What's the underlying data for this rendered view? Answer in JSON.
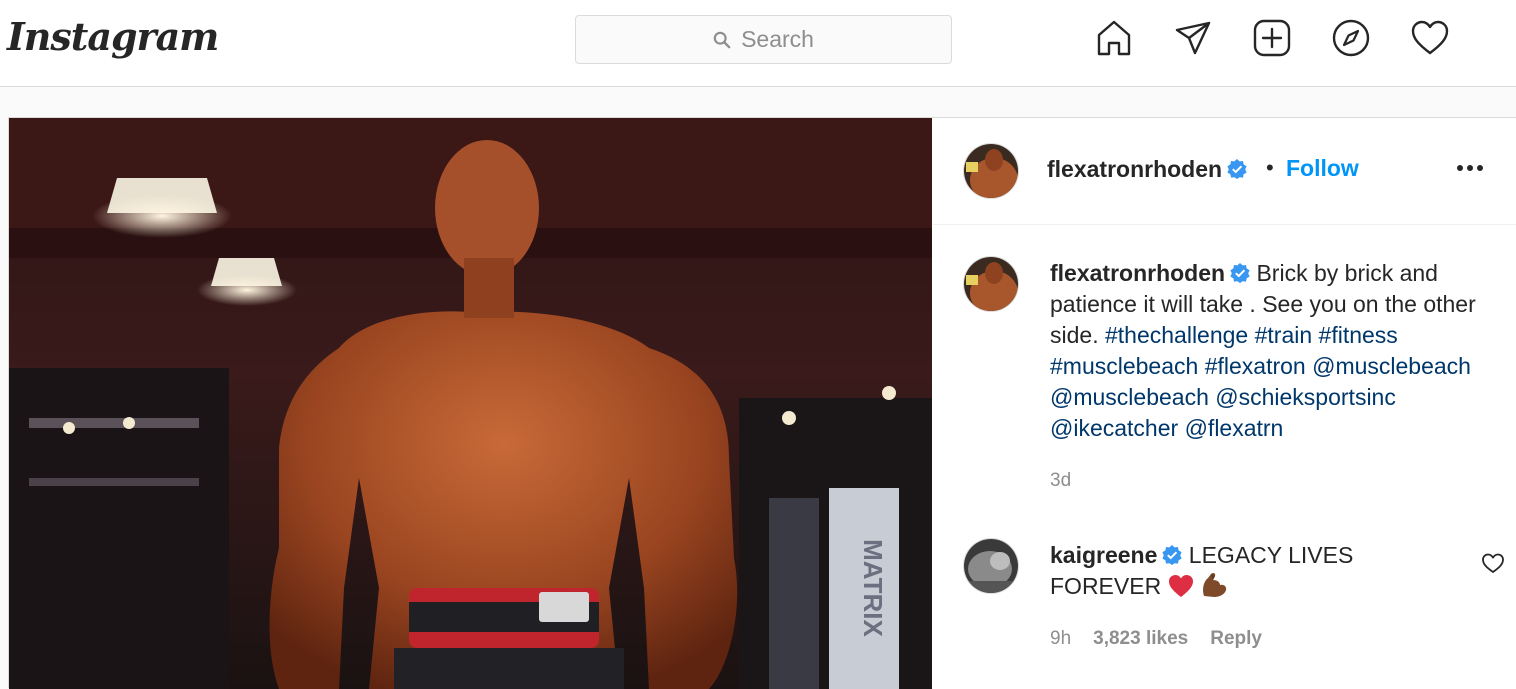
{
  "brand": {
    "logo_text": "Instagram"
  },
  "search": {
    "placeholder": "Search"
  },
  "nav": {
    "icons": [
      "home-icon",
      "direct-message-icon",
      "new-post-icon",
      "explore-compass-icon",
      "activity-heart-icon"
    ]
  },
  "post": {
    "author": "flexatronrhoden",
    "verified": true,
    "separator": "•",
    "follow_label": "Follow",
    "caption": {
      "username": "flexatronrhoden",
      "text_plain": "Brick by brick and patience it will take . See you on the other side.",
      "tags": [
        "#thechallenge",
        "#train",
        "#fitness",
        "#musclebeach",
        "#flexatron",
        "@musclebeach",
        "@musclebeach",
        "@schieksportsinc",
        "@ikecatcher",
        "@flexatrn"
      ],
      "time": "3d"
    },
    "comments": [
      {
        "username": "kaigreene",
        "verified": true,
        "text": "LEGACY LIVES FOREVER",
        "emojis": [
          "red-heart-emoji",
          "flexed-biceps-emoji"
        ],
        "time": "9h",
        "likes": "3,823 likes",
        "reply_label": "Reply"
      }
    ]
  },
  "colors": {
    "accent": "#0095f6",
    "link": "#00376b",
    "verified": "#3897f0",
    "border": "#dbdbdb",
    "muted": "#8e8e8e"
  }
}
